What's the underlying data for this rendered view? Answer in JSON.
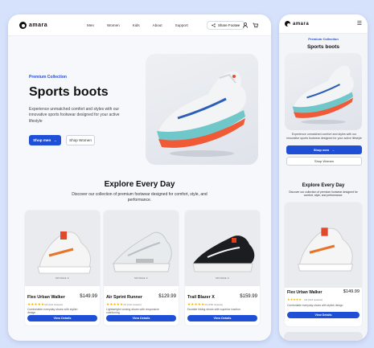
{
  "brand": {
    "name": "amara"
  },
  "nav": {
    "links": [
      "Men",
      "Women",
      "Kids",
      "About",
      "Support"
    ],
    "share_label": "Share Footwe"
  },
  "hero": {
    "eyebrow": "Premium Collection",
    "title": "Sports boots",
    "description": "Experience unmatched comfort and styles with our innovative sports footwear designed for your active lifestyle",
    "primary_label": "Shop men",
    "secondary_label": "Shop Women"
  },
  "explore": {
    "title": "Explore Every Day",
    "subtitle": "Discover our collection of premium footwear designed for comfort, style, and performance."
  },
  "products": [
    {
      "name": "Flex Urban Walker",
      "price": "$149.99",
      "stars": "★★★★★",
      "rating": "4.8 (124 reviews)",
      "description": "Comfortable everyday shoes with stylish design",
      "image_label": "SPONGE K",
      "cta": "View Details"
    },
    {
      "name": "Air Sprint Runner",
      "price": "$129.99",
      "stars": "★★★★★",
      "rating": "4.6 (112 reviews)",
      "description": "Lightweight running shoes with responsive cushioning",
      "image_label": "SPONGE K",
      "cta": "View Details"
    },
    {
      "name": "Trail Blazer X",
      "price": "$159.99",
      "stars": "★★★★★",
      "rating": "4.9 (156 reviews)",
      "description": "Durable hiking shoes with superior traction",
      "image_label": "SPONGE K",
      "cta": "View Details"
    }
  ],
  "mobile": {
    "product": {
      "name": "Flex Urban Walker",
      "price": "$149.99",
      "stars": "★★★★★",
      "rating": "4.8 (124 reviews)",
      "description": "Comfortable everyday shoes with stylish design",
      "cta": "View Details"
    }
  },
  "colors": {
    "accent": "#1f4fd6",
    "background": "#d6e2fb",
    "star": "#f0b400"
  },
  "icons": [
    "share-icon",
    "user-icon",
    "cart-icon",
    "arrow-right-icon",
    "menu-icon",
    "star-icon"
  ]
}
